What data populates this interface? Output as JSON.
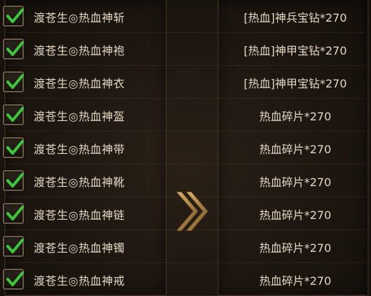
{
  "rows": [
    {
      "name": "渡苍生◎热血神斩",
      "reward": "[热血]神兵宝钻*270",
      "checked": true
    },
    {
      "name": "渡苍生◎热血神袍",
      "reward": "[热血]神甲宝钻*270",
      "checked": true
    },
    {
      "name": "渡苍生◎热血神衣",
      "reward": "[热血]神甲宝钻*270",
      "checked": true
    },
    {
      "name": "渡苍生◎热血神盔",
      "reward": "热血碎片*270",
      "checked": true
    },
    {
      "name": "渡苍生◎热血神带",
      "reward": "热血碎片*270",
      "checked": true
    },
    {
      "name": "渡苍生◎热血神靴",
      "reward": "热血碎片*270",
      "checked": true
    },
    {
      "name": "渡苍生◎热血神链",
      "reward": "热血碎片*270",
      "checked": true
    },
    {
      "name": "渡苍生◎热血神镯",
      "reward": "热血碎片*270",
      "checked": true
    },
    {
      "name": "渡苍生◎热血神戒",
      "reward": "热血碎片*270",
      "checked": true
    }
  ],
  "colors": {
    "check": "#3fc63a",
    "text": "#e3d7c4",
    "arrow": "#b98a45"
  },
  "icons": {
    "check": "check-icon",
    "arrow": "arrow-right-icon"
  }
}
